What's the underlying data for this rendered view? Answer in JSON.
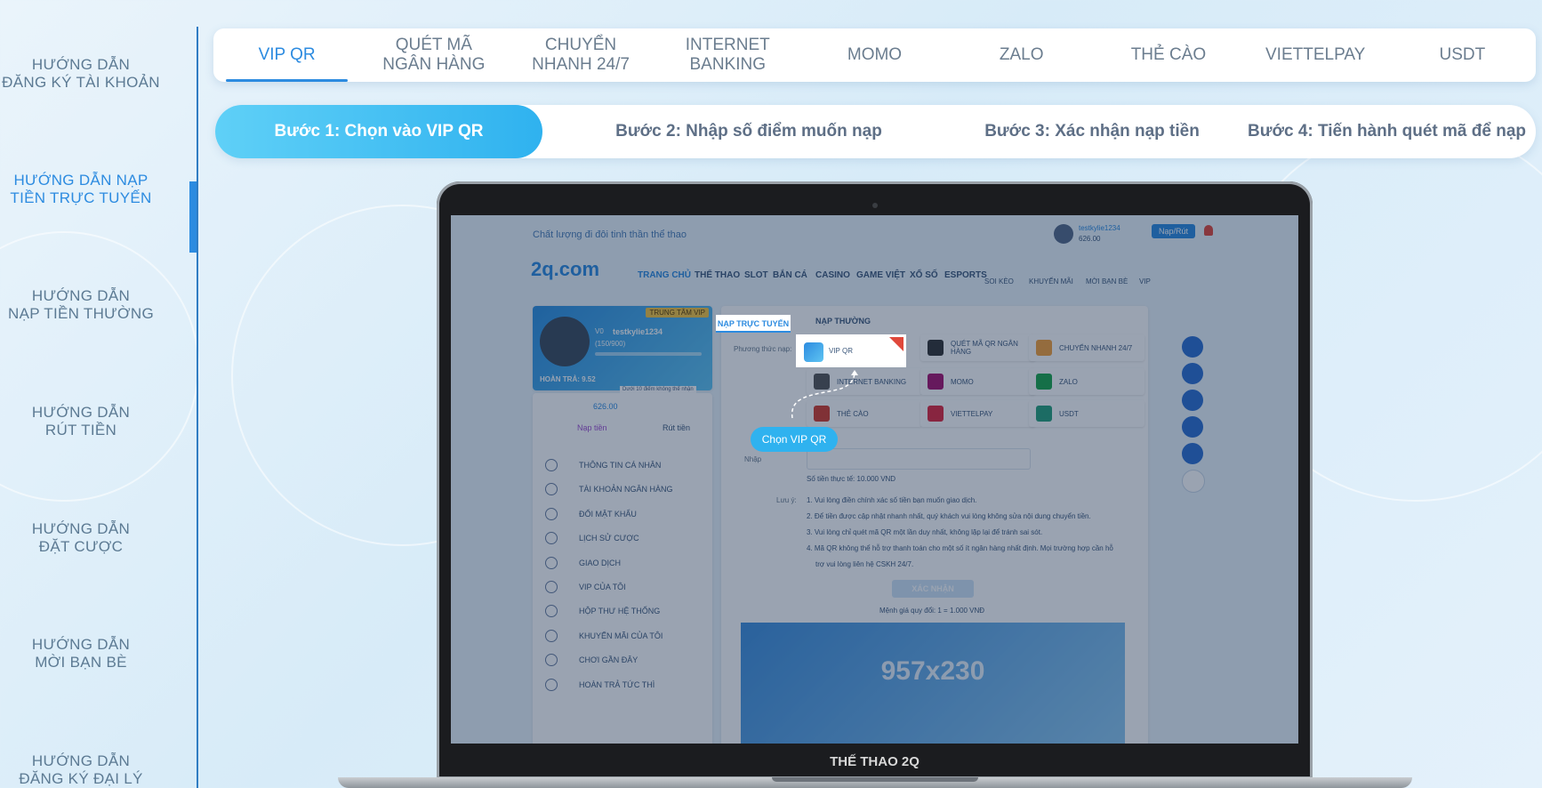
{
  "sidebar": {
    "items": [
      {
        "line1": "HƯỚNG DẪN",
        "line2": "ĐĂNG KÝ TÀI KHOẢN"
      },
      {
        "line1": "HƯỚNG DẪN NẠP",
        "line2": "TIỀN TRỰC TUYẾN"
      },
      {
        "line1": "HƯỚNG DẪN",
        "line2": "NẠP TIỀN THƯỜNG"
      },
      {
        "line1": "HƯỚNG DẪN",
        "line2": "RÚT TIỀN"
      },
      {
        "line1": "HƯỚNG DẪN",
        "line2": "ĐẶT CƯỢC"
      },
      {
        "line1": "HƯỚNG DẪN",
        "line2": "MỜI BẠN BÈ"
      },
      {
        "line1": "HƯỚNG DẪN",
        "line2": "ĐĂNG KÝ ĐẠI LÝ"
      }
    ],
    "active_index": 1
  },
  "tabs": [
    {
      "line1": "VIP QR",
      "line2": ""
    },
    {
      "line1": "QUÉT MÃ",
      "line2": "NGÂN HÀNG"
    },
    {
      "line1": "CHUYỂN",
      "line2": "NHANH 24/7"
    },
    {
      "line1": "INTERNET",
      "line2": "BANKING"
    },
    {
      "line1": "MOMO",
      "line2": ""
    },
    {
      "line1": "ZALO",
      "line2": ""
    },
    {
      "line1": "THẺ CÀO",
      "line2": ""
    },
    {
      "line1": "VIETTELPAY",
      "line2": ""
    },
    {
      "line1": "USDT",
      "line2": ""
    }
  ],
  "steps": [
    "Bước 1: Chọn vào VIP QR",
    "Bước 2: Nhập số điểm muốn nạp",
    "Bước 3: Xác nhận nạp tiền",
    "Bước 4: Tiến hành quét mã để nạp"
  ],
  "laptop": {
    "brand": "THẾ THAO 2Q",
    "screen": {
      "tagline": "Chất lượng đi đôi tinh thần thể thao",
      "username": "testkylie1234",
      "balance": "626.00",
      "deposit_withdraw_button": "Nạp/Rút",
      "logo": "2q.com",
      "nav": [
        "TRANG CHỦ",
        "THỂ THAO",
        "SLOT",
        "BẮN CÁ",
        "CASINO",
        "GAME VIỆT",
        "XỔ SỐ",
        "ESPORTS"
      ],
      "nav_icons": [
        "SOI KÈO",
        "KHUYẾN MÃI",
        "MỜI BẠN BÈ",
        "VIP"
      ],
      "vip_badge": "TRUNG TÂM VIP",
      "vip_level": "V0",
      "progress": "(150/900)",
      "rebate": "HOÀN TRẢ: 9.52",
      "rebate_note": "Dưới 10 điểm không thể nhận",
      "wallet": "626.00",
      "deposit": "Nạp tiền",
      "withdraw": "Rút tiền",
      "menu": [
        "THÔNG TIN CÁ NHÂN",
        "TÀI KHOẢN NGÂN HÀNG",
        "ĐỔI MẬT KHẨU",
        "LỊCH SỬ CƯỢC",
        "GIAO DỊCH",
        "VIP CỦA TÔI",
        "HỘP THƯ HỆ THỐNG",
        "KHUYẾN MÃI CỦA TÔI",
        "CHƠI GẦN ĐÂY",
        "HOÀN TRẢ TỨC THÌ"
      ],
      "tab_online": "NẠP TRỰC TUYẾN",
      "tab_normal": "NẠP THƯỜNG",
      "method_label": "Phương thức nạp:",
      "methods": [
        "VIP QR",
        "QUÉT MÃ QR NGÂN HÀNG",
        "CHUYỂN NHANH 24/7",
        "INTERNET BANKING",
        "MOMO",
        "ZALO",
        "THẺ CÀO",
        "VIETTELPAY",
        "USDT"
      ],
      "amount_label": "Nhập",
      "actual_amount": "Số tiền thực tế: 10.000 VND",
      "notes_label": "Lưu ý:",
      "notes": [
        "1. Vui lòng điền chính xác số tiền bạn muốn giao dịch.",
        "2. Để tiền được cập nhật nhanh nhất, quý khách vui lòng không sửa nội dung chuyển tiền.",
        "3. Vui lòng chỉ quét mã QR một lần duy nhất, không lặp lại để tránh sai sót.",
        "4. Mã QR không thể hỗ trợ thanh toán cho một số ít ngân hàng nhất định. Mọi trường hợp cần hỗ",
        "trợ vui lòng liên hệ CSKH 24/7."
      ],
      "confirm": "XÁC NHẬN",
      "rate": "Mệnh giá quy đổi: 1 = 1.000 VNĐ",
      "banner": "957x230",
      "callout": "Chọn VIP QR"
    }
  }
}
